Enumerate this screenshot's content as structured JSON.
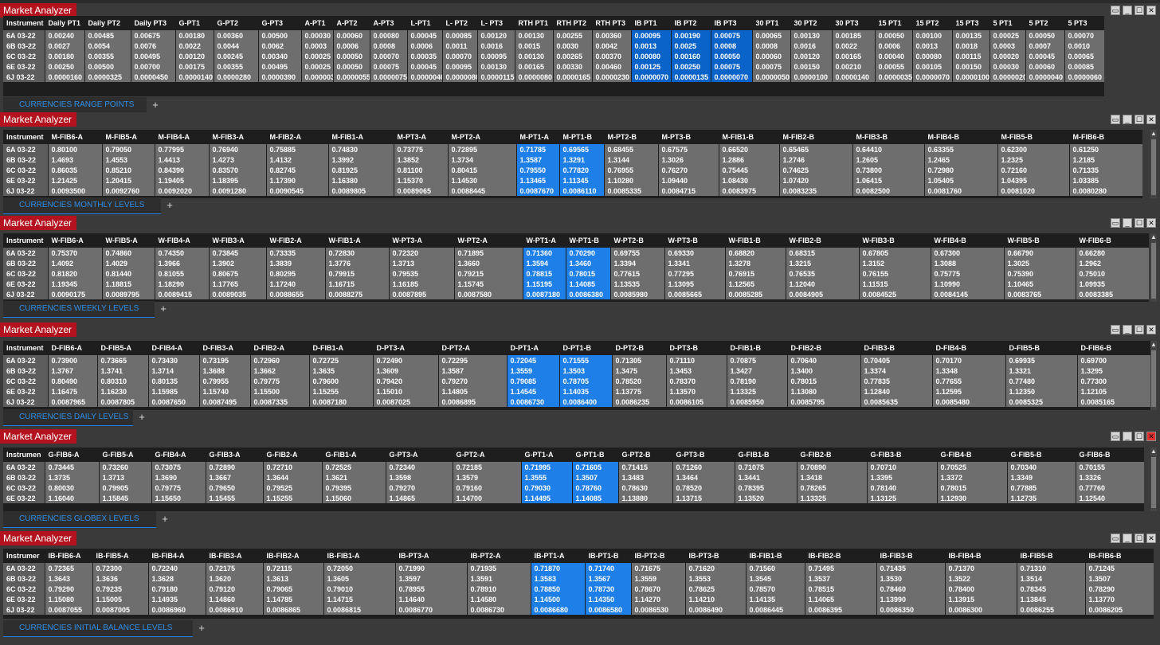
{
  "app_title": "Market Analyzer",
  "window_buttons": {
    "restore": "▭",
    "minimize": "_",
    "maximize": "☐",
    "close": "✕"
  },
  "add_tab_label": "+",
  "colors": {
    "title_bg": "#b3121e",
    "highlight": "#1e7fe8",
    "tab_text": "#2f8ee6"
  },
  "panels": [
    {
      "tab_label": "CURRENCIES RANGE POINTS",
      "headers": [
        "Instrument",
        "Daily PT1",
        "Daily PT2",
        "Daily PT3",
        "G-PT1",
        "G-PT2",
        "G-PT3",
        "A-PT1",
        "A-PT2",
        "A-PT3",
        "L-PT1",
        "L- PT2",
        "L- PT3",
        "RTH PT1",
        "RTH PT2",
        "RTH PT3",
        "IB PT1",
        "IB PT2",
        "IB PT3",
        "30 PT1",
        "30 PT2",
        "30 PT3",
        "15 PT1",
        "15 PT2",
        "15 PT3",
        "5 PT1",
        "5 PT2",
        "5 PT3"
      ],
      "highlight_cols": [
        16,
        17,
        18
      ],
      "rows": [
        [
          "6A 03-22",
          "0.00240",
          "0.00485",
          "0.00675",
          "0.00180",
          "0.00360",
          "0.00500",
          "0.00030",
          "0.00060",
          "0.00080",
          "0.00045",
          "0.00085",
          "0.00120",
          "0.00130",
          "0.00255",
          "0.00360",
          "0.00095",
          "0.00190",
          "0.00075",
          "0.00065",
          "0.00130",
          "0.00185",
          "0.00050",
          "0.00100",
          "0.00135",
          "0.00025",
          "0.00050",
          "0.00070"
        ],
        [
          "6B 03-22",
          "0.0027",
          "0.0054",
          "0.0076",
          "0.0022",
          "0.0044",
          "0.0062",
          "0.0003",
          "0.0006",
          "0.0008",
          "0.0006",
          "0.0011",
          "0.0016",
          "0.0015",
          "0.0030",
          "0.0042",
          "0.0013",
          "0.0025",
          "0.0008",
          "0.0008",
          "0.0016",
          "0.0022",
          "0.0006",
          "0.0013",
          "0.0018",
          "0.0003",
          "0.0007",
          "0.0010"
        ],
        [
          "6C 03-22",
          "0.00180",
          "0.00355",
          "0.00495",
          "0.00120",
          "0.00245",
          "0.00340",
          "0.00025",
          "0.00050",
          "0.00070",
          "0.00035",
          "0.00070",
          "0.00095",
          "0.00130",
          "0.00265",
          "0.00370",
          "0.00080",
          "0.00160",
          "0.00050",
          "0.00060",
          "0.00120",
          "0.00165",
          "0.00040",
          "0.00080",
          "0.00115",
          "0.00020",
          "0.00045",
          "0.00065"
        ],
        [
          "6E 03-22",
          "0.00250",
          "0.00500",
          "0.00700",
          "0.00175",
          "0.00355",
          "0.00495",
          "0.00025",
          "0.00050",
          "0.00075",
          "0.00045",
          "0.00095",
          "0.00130",
          "0.00165",
          "0.00330",
          "0.00460",
          "0.00125",
          "0.00250",
          "0.00075",
          "0.00075",
          "0.00150",
          "0.00210",
          "0.00055",
          "0.00105",
          "0.00150",
          "0.00030",
          "0.00060",
          "0.00085"
        ],
        [
          "6J 03-22",
          "0.0000160",
          "0.0000325",
          "0.0000450",
          "0.0000140",
          "0.0000280",
          "0.0000390",
          "0.000003",
          "0.0000055",
          "0.0000075",
          "0.0000040",
          "0.0000080",
          "0.0000115",
          "0.0000080",
          "0.0000165",
          "0.0000230",
          "0.0000070",
          "0.0000135",
          "0.0000070",
          "0.0000050",
          "0.0000100",
          "0.0000140",
          "0.0000035",
          "0.0000070",
          "0.0000100",
          "0.0000020",
          "0.0000040",
          "0.0000060"
        ]
      ]
    },
    {
      "tab_label": "CURRENCIES MONTHLY LEVELS",
      "headers": [
        "Instrument",
        "M-FIB6-A",
        "M-FIB5-A",
        "M-FIB4-A",
        "M-FIB3-A",
        "M-FIB2-A",
        "M-FIB1-A",
        "M-PT3-A",
        "M-PT2-A",
        "M-PT1-A",
        "M-PT1-B",
        "M-PT2-B",
        "M-PT3-B",
        "M-FIB1-B",
        "M-FIB2-B",
        "M-FIB3-B",
        "M-FIB4-B",
        "M-FIB5-B",
        "M-FIB6-B"
      ],
      "highlight_cols": [
        9,
        10
      ],
      "rows": [
        [
          "6A 03-22",
          "0.80100",
          "0.79050",
          "0.77995",
          "0.76940",
          "0.75885",
          "0.74830",
          "0.73775",
          "0.72895",
          "0.71785",
          "0.69565",
          "0.68455",
          "0.67575",
          "0.66520",
          "0.65465",
          "0.64410",
          "0.63355",
          "0.62300",
          "0.61250"
        ],
        [
          "6B 03-22",
          "1.4693",
          "1.4553",
          "1.4413",
          "1.4273",
          "1.4132",
          "1.3992",
          "1.3852",
          "1.3734",
          "1.3587",
          "1.3291",
          "1.3144",
          "1.3026",
          "1.2886",
          "1.2746",
          "1.2605",
          "1.2465",
          "1.2325",
          "1.2185"
        ],
        [
          "6C 03-22",
          "0.86035",
          "0.85210",
          "0.84390",
          "0.83570",
          "0.82745",
          "0.81925",
          "0.81100",
          "0.80415",
          "0.79550",
          "0.77820",
          "0.76955",
          "0.76270",
          "0.75445",
          "0.74625",
          "0.73800",
          "0.72980",
          "0.72160",
          "0.71335"
        ],
        [
          "6E 03-22",
          "1.21425",
          "1.20415",
          "1.19405",
          "1.18395",
          "1.17390",
          "1.16380",
          "1.15370",
          "1.14530",
          "1.13465",
          "1.11345",
          "1.10280",
          "1.09440",
          "1.08430",
          "1.07420",
          "1.06415",
          "1.05405",
          "1.04395",
          "1.03385"
        ],
        [
          "6J 03-22",
          "0.0093500",
          "0.0092760",
          "0.0092020",
          "0.0091280",
          "0.0090545",
          "0.0089805",
          "0.0089065",
          "0.0088445",
          "0.0087670",
          "0.0086110",
          "0.0085335",
          "0.0084715",
          "0.0083975",
          "0.0083235",
          "0.0082500",
          "0.0081760",
          "0.0081020",
          "0.0080280"
        ]
      ]
    },
    {
      "tab_label": "CURRENCIES WEEKLY LEVELS",
      "headers": [
        "Instrument",
        "W-FIB6-A",
        "W-FIB5-A",
        "W-FIB4-A",
        "W-FIB3-A",
        "W-FIB2-A",
        "W-FIB1-A",
        "W-PT3-A",
        "W-PT2-A",
        "W-PT1-A",
        "W-PT1-B",
        "W-PT2-B",
        "W-PT3-B",
        "W-FIB1-B",
        "W-FIB2-B",
        "W-FIB3-B",
        "W-FIB4-B",
        "W-FIB5-B",
        "W-FIB6-B"
      ],
      "highlight_cols": [
        9,
        10
      ],
      "rows": [
        [
          "6A 03-22",
          "0.75370",
          "0.74860",
          "0.74350",
          "0.73845",
          "0.73335",
          "0.72830",
          "0.72320",
          "0.71895",
          "0.71360",
          "0.70290",
          "0.69755",
          "0.69330",
          "0.68820",
          "0.68315",
          "0.67805",
          "0.67300",
          "0.66790",
          "0.66280"
        ],
        [
          "6B 03-22",
          "1.4092",
          "1.4029",
          "1.3966",
          "1.3902",
          "1.3839",
          "1.3776",
          "1.3713",
          "1.3660",
          "1.3594",
          "1.3460",
          "1.3394",
          "1.3341",
          "1.3278",
          "1.3215",
          "1.3152",
          "1.3088",
          "1.3025",
          "1.2962"
        ],
        [
          "6C 03-22",
          "0.81820",
          "0.81440",
          "0.81055",
          "0.80675",
          "0.80295",
          "0.79915",
          "0.79535",
          "0.79215",
          "0.78815",
          "0.78015",
          "0.77615",
          "0.77295",
          "0.76915",
          "0.76535",
          "0.76155",
          "0.75775",
          "0.75390",
          "0.75010"
        ],
        [
          "6E 03-22",
          "1.19345",
          "1.18815",
          "1.18290",
          "1.17765",
          "1.17240",
          "1.16715",
          "1.16185",
          "1.15745",
          "1.15195",
          "1.14085",
          "1.13535",
          "1.13095",
          "1.12565",
          "1.12040",
          "1.11515",
          "1.10990",
          "1.10465",
          "1.09935"
        ],
        [
          "6J 03-22",
          "0.0090175",
          "0.0089795",
          "0.0089415",
          "0.0089035",
          "0.0088655",
          "0.0088275",
          "0.0087895",
          "0.0087580",
          "0.0087180",
          "0.0086380",
          "0.0085980",
          "0.0085665",
          "0.0085285",
          "0.0084905",
          "0.0084525",
          "0.0084145",
          "0.0083765",
          "0.0083385"
        ]
      ]
    },
    {
      "tab_label": "CURRENCIES DAILY LEVELS",
      "headers": [
        "Instrument",
        "D-FIB6-A",
        "D-FIB5-A",
        "D-FIB4-A",
        "D-FIB3-A",
        "D-FIB2-A",
        "D-FIB1-A",
        "D-PT3-A",
        "D-PT2-A",
        "D-PT1-A",
        "D-PT1-B",
        "D-PT2-B",
        "D-PT3-B",
        "D-FIB1-B",
        "D-FIB2-B",
        "D-FIB3-B",
        "D-FIB4-B",
        "D-FIB5-B",
        "D-FIB6-B"
      ],
      "highlight_cols": [
        9,
        10
      ],
      "rows": [
        [
          "6A 03-22",
          "0.73900",
          "0.73665",
          "0.73430",
          "0.73195",
          "0.72960",
          "0.72725",
          "0.72490",
          "0.72295",
          "0.72045",
          "0.71555",
          "0.71305",
          "0.71110",
          "0.70875",
          "0.70640",
          "0.70405",
          "0.70170",
          "0.69935",
          "0.69700"
        ],
        [
          "6B 03-22",
          "1.3767",
          "1.3741",
          "1.3714",
          "1.3688",
          "1.3662",
          "1.3635",
          "1.3609",
          "1.3587",
          "1.3559",
          "1.3503",
          "1.3475",
          "1.3453",
          "1.3427",
          "1.3400",
          "1.3374",
          "1.3348",
          "1.3321",
          "1.3295"
        ],
        [
          "6C 03-22",
          "0.80490",
          "0.80310",
          "0.80135",
          "0.79955",
          "0.79775",
          "0.79600",
          "0.79420",
          "0.79270",
          "0.79085",
          "0.78705",
          "0.78520",
          "0.78370",
          "0.78190",
          "0.78015",
          "0.77835",
          "0.77655",
          "0.77480",
          "0.77300"
        ],
        [
          "6E 03-22",
          "1.16475",
          "1.16230",
          "1.15985",
          "1.15740",
          "1.15500",
          "1.15255",
          "1.15010",
          "1.14805",
          "1.14545",
          "1.14035",
          "1.13775",
          "1.13570",
          "1.13325",
          "1.13080",
          "1.12840",
          "1.12595",
          "1.12350",
          "1.12105"
        ],
        [
          "6J 03-22",
          "0.0087965",
          "0.0087805",
          "0.0087650",
          "0.0087495",
          "0.0087335",
          "0.0087180",
          "0.0087025",
          "0.0086895",
          "0.0086730",
          "0.0086400",
          "0.0086235",
          "0.0086105",
          "0.0085950",
          "0.0085795",
          "0.0085635",
          "0.0085480",
          "0.0085325",
          "0.0085165"
        ]
      ]
    },
    {
      "tab_label": "CURRENCIES GLOBEX LEVELS",
      "headers": [
        "Instrumen",
        "G-FIB6-A",
        "G-FIB5-A",
        "G-FIB4-A",
        "G-FIB3-A",
        "G-FIB2-A",
        "G-FIB1-A",
        "G-PT3-A",
        "G-PT2-A",
        "G-PT1-A",
        "G-PT1-B",
        "G-PT2-B",
        "G-PT3-B",
        "G-FIB1-B",
        "G-FIB2-B",
        "G-FIB3-B",
        "G-FIB4-B",
        "G-FIB5-B",
        "G-FIB6-B"
      ],
      "highlight_cols": [
        9,
        10
      ],
      "rows": [
        [
          "6A 03-22",
          "0.73445",
          "0.73260",
          "0.73075",
          "0.72890",
          "0.72710",
          "0.72525",
          "0.72340",
          "0.72185",
          "0.71995",
          "0.71605",
          "0.71415",
          "0.71260",
          "0.71075",
          "0.70890",
          "0.70710",
          "0.70525",
          "0.70340",
          "0.70155"
        ],
        [
          "6B 03-22",
          "1.3735",
          "1.3713",
          "1.3690",
          "1.3667",
          "1.3644",
          "1.3621",
          "1.3598",
          "1.3579",
          "1.3555",
          "1.3507",
          "1.3483",
          "1.3464",
          "1.3441",
          "1.3418",
          "1.3395",
          "1.3372",
          "1.3349",
          "1.3326"
        ],
        [
          "6C 03-22",
          "0.80030",
          "0.79905",
          "0.79775",
          "0.79650",
          "0.79525",
          "0.79395",
          "0.79270",
          "0.79160",
          "0.79030",
          "0.78760",
          "0.78630",
          "0.78520",
          "0.78395",
          "0.78265",
          "0.78140",
          "0.78015",
          "0.77885",
          "0.77760"
        ],
        [
          "6E 03-22",
          "1.16040",
          "1.15845",
          "1.15650",
          "1.15455",
          "1.15255",
          "1.15060",
          "1.14865",
          "1.14700",
          "1.14495",
          "1.14085",
          "1.13880",
          "1.13715",
          "1.13520",
          "1.13325",
          "1.13125",
          "1.12930",
          "1.12735",
          "1.12540"
        ]
      ]
    },
    {
      "tab_label": "CURRENCIES INITIAL BALANCE LEVELS",
      "headers": [
        "Instrumer",
        "IB-FIB6-A",
        "IB-FIB5-A",
        "IB-FIB4-A",
        "IB-FIB3-A",
        "IB-FIB2-A",
        "IB-FIB1-A",
        "IB-PT3-A",
        "IB-PT2-A",
        "IB-PT1-A",
        "IB-PT1-B",
        "IB-PT2-B",
        "IB-PT3-B",
        "IB-FIB1-B",
        "IB-FIB2-B",
        "IB-FIB3-B",
        "IB-FIB4-B",
        "IB-FIB5-B",
        "IB-FIB6-B"
      ],
      "highlight_cols": [
        9,
        10
      ],
      "rows": [
        [
          "6A 03-22",
          "0.72365",
          "0.72300",
          "0.72240",
          "0.72175",
          "0.72115",
          "0.72050",
          "0.71990",
          "0.71935",
          "0.71870",
          "0.71740",
          "0.71675",
          "0.71620",
          "0.71560",
          "0.71495",
          "0.71435",
          "0.71370",
          "0.71310",
          "0.71245"
        ],
        [
          "6B 03-22",
          "1.3643",
          "1.3636",
          "1.3628",
          "1.3620",
          "1.3613",
          "1.3605",
          "1.3597",
          "1.3591",
          "1.3583",
          "1.3567",
          "1.3559",
          "1.3553",
          "1.3545",
          "1.3537",
          "1.3530",
          "1.3522",
          "1.3514",
          "1.3507"
        ],
        [
          "6C 03-22",
          "0.79290",
          "0.79235",
          "0.79180",
          "0.79120",
          "0.79065",
          "0.79010",
          "0.78955",
          "0.78910",
          "0.78850",
          "0.78730",
          "0.78670",
          "0.78625",
          "0.78570",
          "0.78515",
          "0.78460",
          "0.78400",
          "0.78345",
          "0.78290"
        ],
        [
          "6E 03-22",
          "1.15080",
          "1.15005",
          "1.14935",
          "1.14860",
          "1.14785",
          "1.14715",
          "1.14640",
          "1.14580",
          "1.14500",
          "1.14350",
          "1.14270",
          "1.14210",
          "1.14135",
          "1.14065",
          "1.13990",
          "1.13915",
          "1.13845",
          "1.13770"
        ],
        [
          "6J 03-22",
          "0.0087055",
          "0.0087005",
          "0.0086960",
          "0.0086910",
          "0.0086865",
          "0.0086815",
          "0.0086770",
          "0.0086730",
          "0.0086680",
          "0.0086580",
          "0.0086530",
          "0.0086490",
          "0.0086445",
          "0.0086395",
          "0.0086350",
          "0.0086300",
          "0.0086255",
          "0.0086205"
        ]
      ]
    }
  ]
}
